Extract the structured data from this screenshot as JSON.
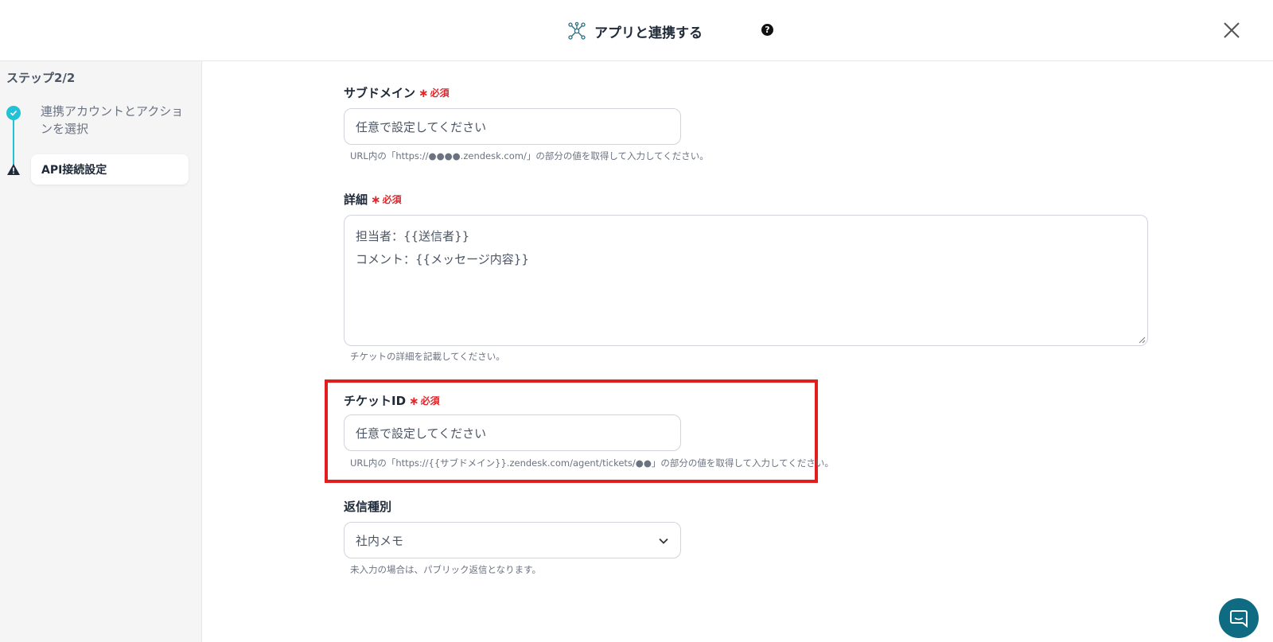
{
  "header": {
    "title": "アプリと連携する",
    "help_glyph": "?"
  },
  "sidebar": {
    "step_title": "ステップ2/2",
    "steps": [
      {
        "label": "連携アカウントとアクションを選択",
        "status": "done"
      },
      {
        "label": "API接続設定",
        "status": "warning"
      }
    ]
  },
  "form": {
    "required_text": "必須",
    "subdomain": {
      "label": "サブドメイン",
      "placeholder": "任意で設定してください",
      "hint": "URL内の「https://●●●●.zendesk.com/」の部分の値を取得して入力してください。"
    },
    "detail": {
      "label": "詳細",
      "lines": [
        "担当者：{{送信者}}",
        "コメント：{{メッセージ内容}}"
      ],
      "hint": "チケットの詳細を記載してください。"
    },
    "ticket_id": {
      "label": "チケットID",
      "placeholder": "任意で設定してください",
      "hint": "URL内の「https://{{サブドメイン}}.zendesk.com/agent/tickets/●●」の部分の値を取得して入力してください。"
    },
    "reply_type": {
      "label": "返信種別",
      "value": "社内メモ",
      "hint": "未入力の場合は、パブリック返信となります。"
    }
  },
  "colors": {
    "accent": "#22c1d6",
    "required": "#e0262b",
    "highlight": "#e11d1d",
    "chat": "#0e6b82"
  },
  "icons": [
    "network-icon",
    "help-icon",
    "close-icon",
    "check-icon",
    "warning-icon",
    "chevron-down-icon",
    "chat-icon"
  ]
}
